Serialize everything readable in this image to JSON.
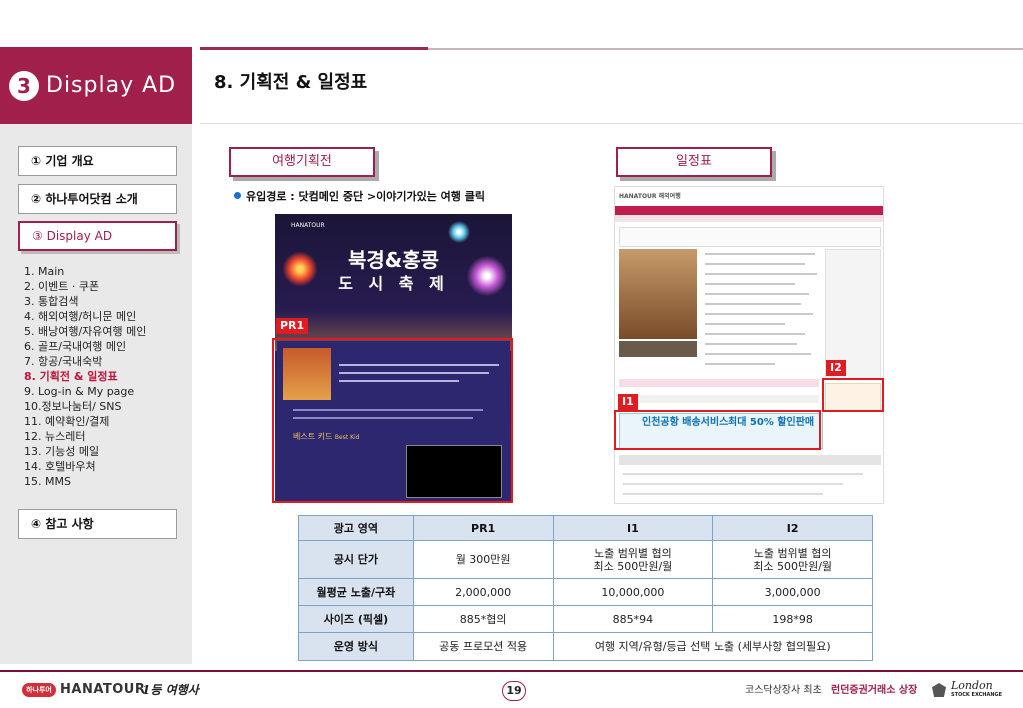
{
  "header": {
    "section_number": "3",
    "section_title": "Display AD",
    "page_title": "8.  기획전 & 일정표"
  },
  "sidebar": {
    "items": [
      {
        "label": "① 기업 개요"
      },
      {
        "label": "② 하나투어닷컴 소개"
      },
      {
        "label": "③ Display AD"
      },
      {
        "label": "④ 참고 사항"
      }
    ],
    "sub_items": [
      "1. Main",
      "2. 이벤트 · 쿠폰",
      "3. 통합검색",
      "4. 해외여행/허니문 메인",
      "5. 배낭여행/자유여행 메인",
      "6. 골프/국내여행 메인",
      "7. 항공/국내숙박",
      "8. 기획전 & 일정표",
      "9. Log-in & My page",
      "10.정보나눔터/ SNS",
      "11. 예약확인/결제",
      "12. 뉴스레터",
      "13. 기능성 메일",
      "14. 호텔바우쳐",
      "15. MMS"
    ],
    "current_index": 7
  },
  "main": {
    "left_tag": "여행기획전",
    "right_tag": "일정표",
    "bullet": "유입경로 : 닷컴메인 중단 >이야기가있는 여행 클릭",
    "labels": {
      "pr1": "PR1",
      "i1": "I1",
      "i2": "I2"
    },
    "banner": {
      "brand": "HANATOUR",
      "headline1": "북경&홍콩",
      "headline2": "도 시 축 제",
      "movie_title": "베스트 키드",
      "movie_subtitle": "Best Kid"
    },
    "shot": {
      "brand": "HANATOUR 해외여행",
      "ad1_title": "인천공항 배송서비스",
      "ad2_title": "최대 50% 할인판매"
    }
  },
  "table": {
    "header": [
      "광고 영역",
      "PR1",
      "I1",
      "I2"
    ],
    "rows": [
      {
        "label": "공시 단가",
        "pr1": "월 300만원",
        "i1_line1": "노출 범위별 협의",
        "i1_line2": "최소 500만원/월",
        "i2_line1": "노출 범위별 협의",
        "i2_line2": "최소 500만원/월"
      },
      {
        "label": "월평균 노출/구좌",
        "pr1": "2,000,000",
        "i1": "10,000,000",
        "i2": "3,000,000"
      },
      {
        "label": "사이즈 (픽셀)",
        "pr1": "885*협의",
        "i1": "885*94",
        "i2": "198*98"
      },
      {
        "label": "운영 방식",
        "pr1": "공동 프로모션 적용",
        "i1i2": "여행 지역/유형/등급  선택 노출 (세부사항  협의필요)"
      }
    ]
  },
  "footer": {
    "logo_badge": "하나투어",
    "logo_text": "HANATOUR",
    "logo_slogan": "1등 여행사",
    "page_number": "19",
    "right_text_1": "코스닥상장사 최초",
    "right_text_2": "런던증권거래소 상장",
    "london": "London",
    "lse": "STOCK EXCHANGE"
  },
  "colors": {
    "brand": "#a01f4b",
    "highlight_red": "#e01b22",
    "table_header": "#d9e3f0",
    "table_border": "#7fa3c8"
  }
}
